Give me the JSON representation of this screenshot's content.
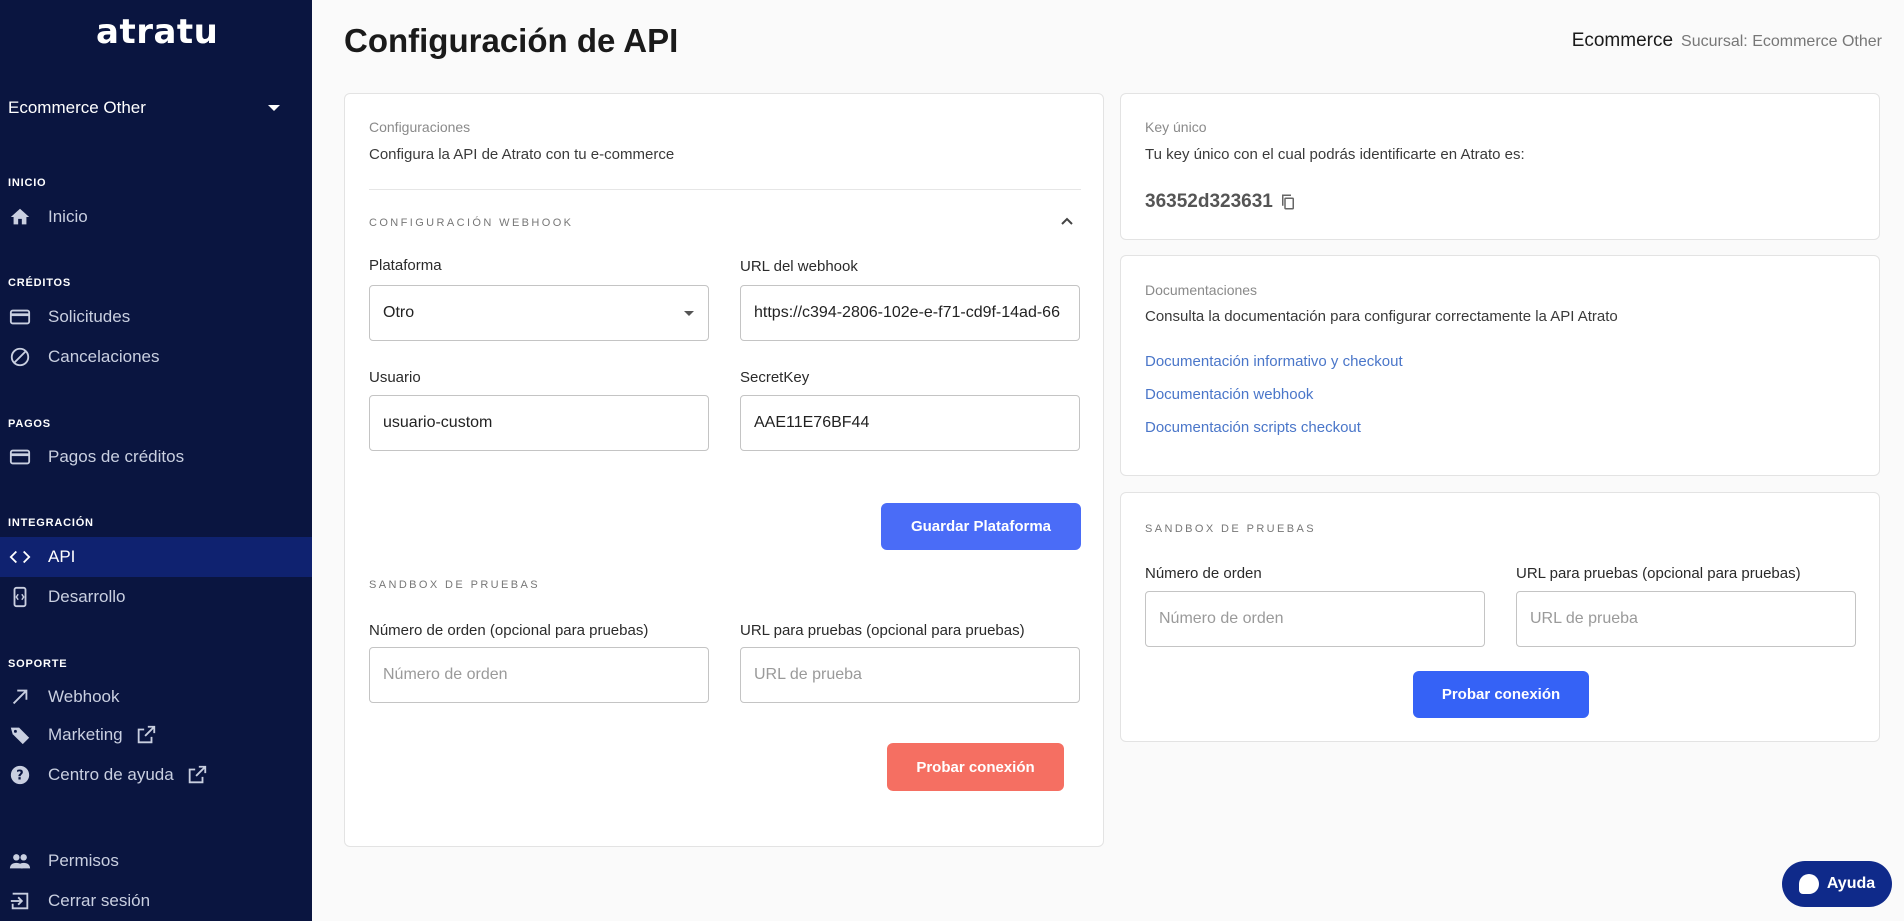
{
  "sidebar": {
    "logo": "atratu",
    "branch": "Ecommerce Other",
    "sections": {
      "inicio": "INICIO",
      "creditos": "CRÉDITOS",
      "pagos": "PAGOS",
      "integracion": "INTEGRACIÓN",
      "soporte": "SOPORTE"
    },
    "items": {
      "inicio": "Inicio",
      "solicitudes": "Solicitudes",
      "cancelaciones": "Cancelaciones",
      "pagos_creditos": "Pagos de créditos",
      "api": "API",
      "desarrollo": "Desarrollo",
      "webhook": "Webhook",
      "marketing": "Marketing",
      "centro_ayuda": "Centro de ayuda",
      "permisos": "Permisos",
      "cerrar_sesion": "Cerrar sesión"
    },
    "active_item": "api"
  },
  "header": {
    "title": "Configuración de API",
    "company": "Ecommerce",
    "sucursal": "Sucursal: Ecommerce Other"
  },
  "config_card": {
    "label": "Configuraciones",
    "description": "Configura la API de Atrato con tu e-commerce",
    "webhook_section": "CONFIGURACIÓN WEBHOOK",
    "platform_label": "Plataforma",
    "platform_value": "Otro",
    "webhook_url_label": "URL del webhook",
    "webhook_url_value": "https://c394-2806-102e-e-f71-cd9f-14ad-66",
    "user_label": "Usuario",
    "user_value": "usuario-custom",
    "secret_label": "SecretKey",
    "secret_value": "AAE11E76BF44",
    "save_button": "Guardar Plataforma",
    "sandbox_section": "SANDBOX DE PRUEBAS",
    "order_label": "Número de orden (opcional para pruebas)",
    "order_placeholder": "Número de orden",
    "test_url_label": "URL para pruebas (opcional para pruebas)",
    "test_url_placeholder": "URL de prueba",
    "test_button": "Probar conexión"
  },
  "key_card": {
    "label": "Key único",
    "description": "Tu key único con el cual podrás identificarte en Atrato es:",
    "key_value": "36352d323631"
  },
  "docs_card": {
    "label": "Documentaciones",
    "description": "Consulta la documentación para configurar correctamente la API Atrato",
    "links": [
      "Documentación informativo y checkout",
      "Documentación webhook",
      "Documentación scripts checkout"
    ]
  },
  "sandbox_card": {
    "section": "SANDBOX DE PRUEBAS",
    "order_label": "Número de orden",
    "order_placeholder": "Número de orden",
    "test_url_label": "URL para pruebas (opcional para pruebas)",
    "test_url_placeholder": "URL de prueba",
    "test_button": "Probar conexión"
  },
  "help_button": "Ayuda",
  "colors": {
    "sidebar_bg": "#0a1540",
    "sidebar_active": "#0f2270",
    "primary_blue": "#4a6cf7",
    "danger_red": "#f56f62",
    "link_blue": "#4a76c9"
  }
}
